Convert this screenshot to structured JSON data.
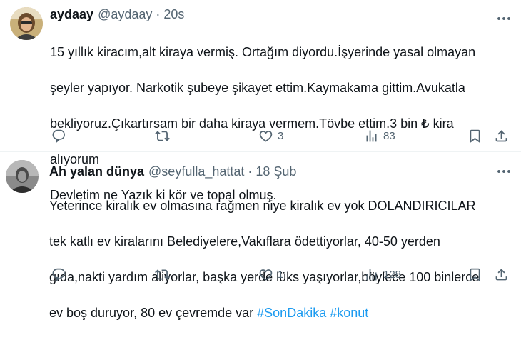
{
  "tweets": [
    {
      "name": "aydaay",
      "handle": "@aydaay",
      "separator": "·",
      "time": "20s",
      "text_lines": [
        "15 yıllık kiracım,alt kiraya vermiş. Ortağım diyordu.İşyerinde yasal olmayan",
        "şeyler yapıyor. Narkotik şubeye şikayet ettim.Kaymakama  gittim.Avukatla",
        "bekliyoruz.Çıkartırsam bir daha kiraya vermem.Tövbe ettim.3 bin ₺ kira",
        "alıyorum",
        "Devletim ne Yazık ki kör ve topal olmuş."
      ],
      "likes": "3",
      "views": "83"
    },
    {
      "name": "Ah yalan dünya",
      "handle": "@seyfulla_hattat",
      "separator": "·",
      "time": "18 Şub",
      "text_lines": [
        "Yeterince kiralık ev olmasına rağmen niye kiralık ev yok DOLANDIRICILAR",
        "tek katlı ev kiralarını Belediyelere,Vakıflara ödettiyorlar, 40-50 yerden",
        "gıda,nakti yardım aliyorlar, başka yerde lüks yaşıyorlar,böylece 100 binlerce",
        "ev boş duruyor, 80 ev çevremde var "
      ],
      "hashtags": [
        "#SonDakika",
        "#konut"
      ],
      "likes": "1",
      "views": "128"
    }
  ],
  "icons": [
    "more-icon",
    "reply-icon",
    "retweet-icon",
    "like-icon",
    "views-icon",
    "bookmark-icon",
    "share-icon"
  ],
  "colors": {
    "text": "#0f1419",
    "secondary": "#536471",
    "link": "#1d9bf0",
    "divider": "#eff3f4"
  }
}
